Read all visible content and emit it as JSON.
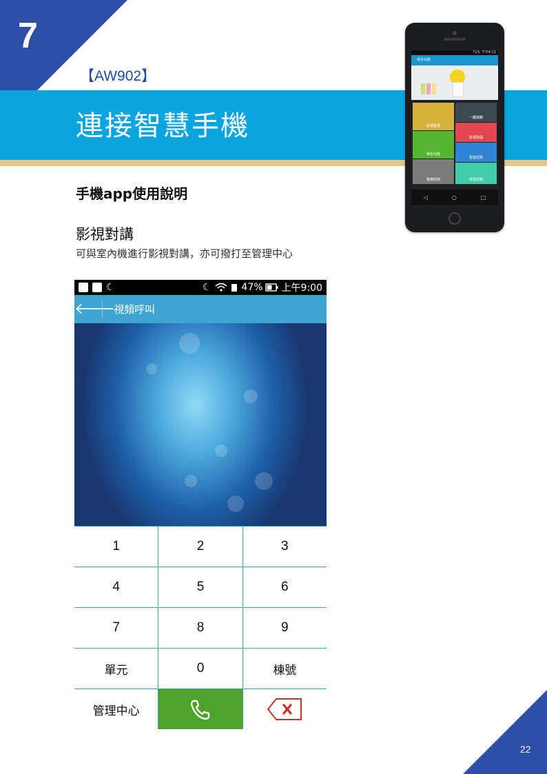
{
  "chapter_number": "7",
  "model_label": "【AW902】",
  "banner_title": "連接智慧手機",
  "subheading": "手機app使用說明",
  "section": {
    "title": "影視對講",
    "description": "可與室內機進行影視對講，亦可撥打至管理中心"
  },
  "phone_mockup": {
    "status_text": "71% 下午4:11",
    "app_title": "保全功能",
    "tiles": [
      {
        "label": "影視監視",
        "color": "#d8b23a"
      },
      {
        "label": "一鍵開鎖",
        "color": "#3b4a4f"
      },
      {
        "label": "影視對講",
        "color": "#e0484e"
      },
      {
        "label": "保全功能",
        "color": "#56b530"
      },
      {
        "label": "智能控制",
        "color": "#2f84d6"
      },
      {
        "label": "電梯控制",
        "color": "#7a7a7a"
      },
      {
        "label": "情境控制",
        "color": "#3ecfa8"
      }
    ]
  },
  "app": {
    "status_bar": {
      "battery": "47%",
      "time": "上午9:00"
    },
    "title": "視頻呼叫",
    "keypad": [
      [
        "1",
        "2",
        "3"
      ],
      [
        "4",
        "5",
        "6"
      ],
      [
        "7",
        "8",
        "9"
      ],
      [
        "單元",
        "0",
        "棟號"
      ]
    ],
    "bottom_row": {
      "management_label": "管理中心",
      "call_icon": "phone-icon",
      "delete_icon": "backspace-icon"
    }
  },
  "colors": {
    "brand_blue": "#2b4fa6",
    "banner_cyan": "#0aa4e0",
    "accent_gold": "#e3c98d",
    "app_bar": "#3ea5d3",
    "call_green": "#4ea22a",
    "delete_red": "#c9302c"
  },
  "page_number": "22"
}
